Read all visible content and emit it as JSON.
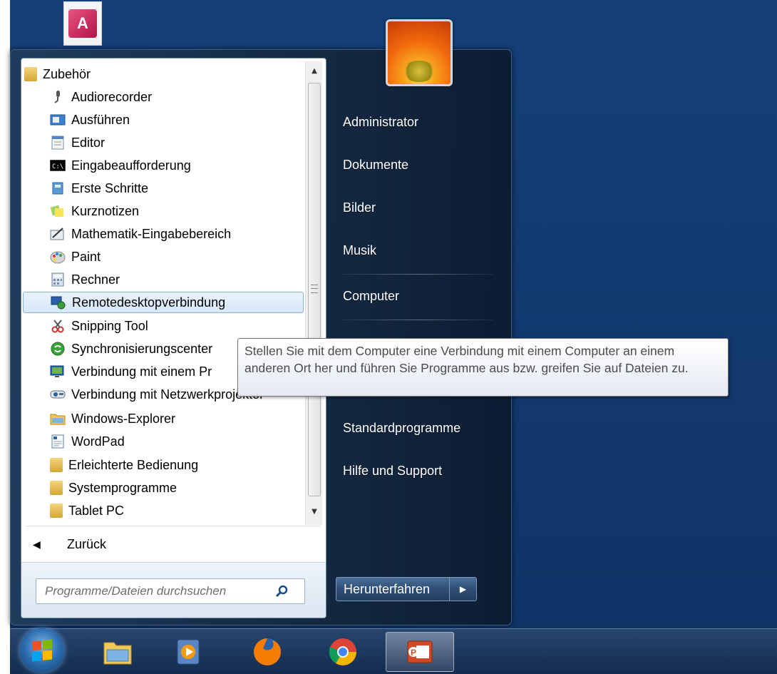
{
  "left_pane": {
    "folder_header": "Zubehör",
    "programs": [
      {
        "label": "Zubehör",
        "icon": "folder-icon",
        "indent": 0
      },
      {
        "label": "Audiorecorder",
        "icon": "microphone-icon",
        "indent": 1
      },
      {
        "label": "Ausführen",
        "icon": "run-icon",
        "indent": 1
      },
      {
        "label": "Editor",
        "icon": "notepad-icon",
        "indent": 1
      },
      {
        "label": "Eingabeaufforderung",
        "icon": "command-prompt-icon",
        "indent": 1
      },
      {
        "label": "Erste Schritte",
        "icon": "getting-started-icon",
        "indent": 1
      },
      {
        "label": "Kurznotizen",
        "icon": "sticky-notes-icon",
        "indent": 1
      },
      {
        "label": "Mathematik-Eingabebereich",
        "icon": "math-input-icon",
        "indent": 1
      },
      {
        "label": "Paint",
        "icon": "paint-palette-icon",
        "indent": 1
      },
      {
        "label": "Rechner",
        "icon": "calculator-icon",
        "indent": 1
      },
      {
        "label": "Remotedesktopverbindung",
        "icon": "remote-desktop-icon",
        "indent": 1,
        "selected": true
      },
      {
        "label": "Snipping Tool",
        "icon": "scissors-icon",
        "indent": 1
      },
      {
        "label": "Synchronisierungscenter",
        "icon": "sync-icon",
        "indent": 1
      },
      {
        "label": "Verbindung mit einem Pr",
        "icon": "projector-connect-icon",
        "indent": 1
      },
      {
        "label": "Verbindung mit Netzwerkprojektor",
        "icon": "network-projector-icon",
        "indent": 1
      },
      {
        "label": "Windows-Explorer",
        "icon": "explorer-folder-icon",
        "indent": 1
      },
      {
        "label": "WordPad",
        "icon": "wordpad-icon",
        "indent": 1
      },
      {
        "label": "Erleichterte Bedienung",
        "icon": "folder-icon",
        "indent": 1
      },
      {
        "label": "Systemprogramme",
        "icon": "folder-icon",
        "indent": 1
      },
      {
        "label": "Tablet PC",
        "icon": "folder-icon",
        "indent": 1
      }
    ],
    "back_label": "Zurück",
    "search_placeholder": "Programme/Dateien durchsuchen"
  },
  "right_pane": {
    "items": [
      "Administrator",
      "Dokumente",
      "Bilder",
      "Musik",
      "Computer",
      "Standardprogramme",
      "Hilfe und Support"
    ],
    "shutdown_label": "Herunterfahren"
  },
  "tooltip": {
    "text": "Stellen Sie mit dem Computer eine Verbindung mit einem Computer an einem anderen Ort her und führen Sie Programme aus bzw. greifen Sie auf Dateien zu."
  },
  "taskbar": {
    "pinned": [
      "windows-explorer-icon",
      "media-player-icon",
      "firefox-icon",
      "chrome-icon",
      "powerpoint-icon"
    ]
  },
  "desktop": {
    "shortcut_icon": "access-icon"
  },
  "colors": {
    "desktop": "#133a70",
    "selection": "#d6e8fa",
    "tooltip_text": "#4b4b4b"
  }
}
